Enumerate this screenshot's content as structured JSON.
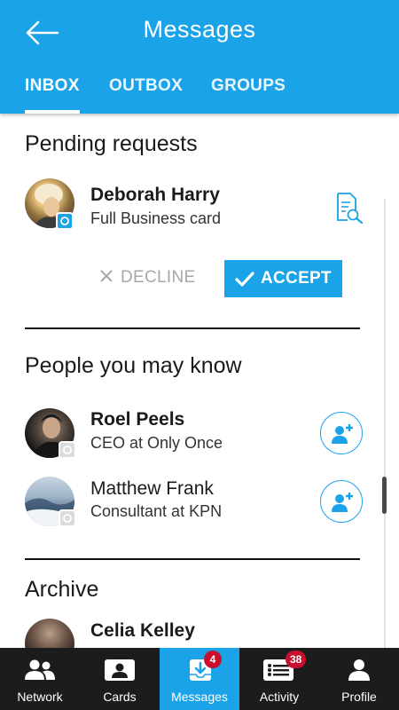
{
  "header": {
    "title": "Messages",
    "tabs": [
      {
        "label": "INBOX",
        "active": true
      },
      {
        "label": "OUTBOX",
        "active": false
      },
      {
        "label": "GROUPS",
        "active": false
      }
    ]
  },
  "pending": {
    "section_title": "Pending requests",
    "request": {
      "name": "Deborah Harry",
      "subtitle": "Full Business card",
      "decline_label": "DECLINE",
      "accept_label": "ACCEPT"
    }
  },
  "suggestions": {
    "section_title": "People you may know",
    "people": [
      {
        "name": "Roel Peels",
        "subtitle": "CEO at Only Once"
      },
      {
        "name": "Matthew Frank",
        "subtitle": "Consultant at KPN"
      }
    ]
  },
  "archive": {
    "section_title": "Archive",
    "items": [
      {
        "name": "Celia Kelley"
      }
    ]
  },
  "bottom_nav": {
    "items": [
      {
        "label": "Network",
        "icon": "people-icon",
        "active": false
      },
      {
        "label": "Cards",
        "icon": "card-icon",
        "active": false
      },
      {
        "label": "Messages",
        "icon": "inbox-icon",
        "active": true,
        "badge": "4"
      },
      {
        "label": "Activity",
        "icon": "list-icon",
        "active": false,
        "badge": "38"
      },
      {
        "label": "Profile",
        "icon": "person-icon",
        "active": false
      }
    ]
  },
  "colors": {
    "accent": "#1aa3e8",
    "nav_background": "#1c1c1c",
    "badge": "#c8102e",
    "decline_text": "#a8a8a8"
  }
}
